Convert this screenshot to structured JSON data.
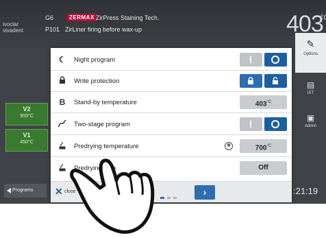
{
  "header": {
    "logo_top": "· · · ·",
    "logo_line1": "ivoclar",
    "logo_line2": "vivadent",
    "program_code": "G6",
    "brand_badge": "ZERMAX",
    "program_title": "ZirPress Staining Tech.",
    "program_number": "P101",
    "program_subtitle": "ZirLiner firing before wax-up",
    "temperature": "403",
    "temperature_unit": "°C"
  },
  "left_sidebar": {
    "v_items": [
      {
        "label": "V2",
        "temp": "959°C"
      },
      {
        "label": "V1",
        "temp": "450°C"
      }
    ],
    "programs_label": "Programs"
  },
  "right_sidebar": {
    "options_label": "Options",
    "ist_label": "IST",
    "admin_label": "Admin",
    "clock": ":21:19"
  },
  "options_panel": {
    "rows": [
      {
        "label": "Night program",
        "icon": "moon-icon",
        "type": "toggle",
        "state": "off"
      },
      {
        "label": "Write protection",
        "icon": "lock-icon",
        "type": "lock-toggle",
        "state": "unlocked"
      },
      {
        "label": "Stand-by temperature",
        "icon": "B",
        "type": "value",
        "value": "403",
        "unit": "°C"
      },
      {
        "label": "Two-stage program",
        "icon": "two-stage-icon",
        "type": "toggle",
        "state": "off"
      },
      {
        "label": "Predrying temperature",
        "icon": "predrying-icon",
        "type": "value",
        "value": "700",
        "unit": "°C"
      },
      {
        "label": "Predrying time",
        "icon": "predrying-icon",
        "type": "value",
        "value": "Off",
        "unit": ""
      }
    ],
    "footer": {
      "close_label": "close"
    }
  },
  "colors": {
    "accent_blue": "#1b5fa3",
    "brand_red": "#b0103a",
    "v_green": "#3a7a2e"
  }
}
